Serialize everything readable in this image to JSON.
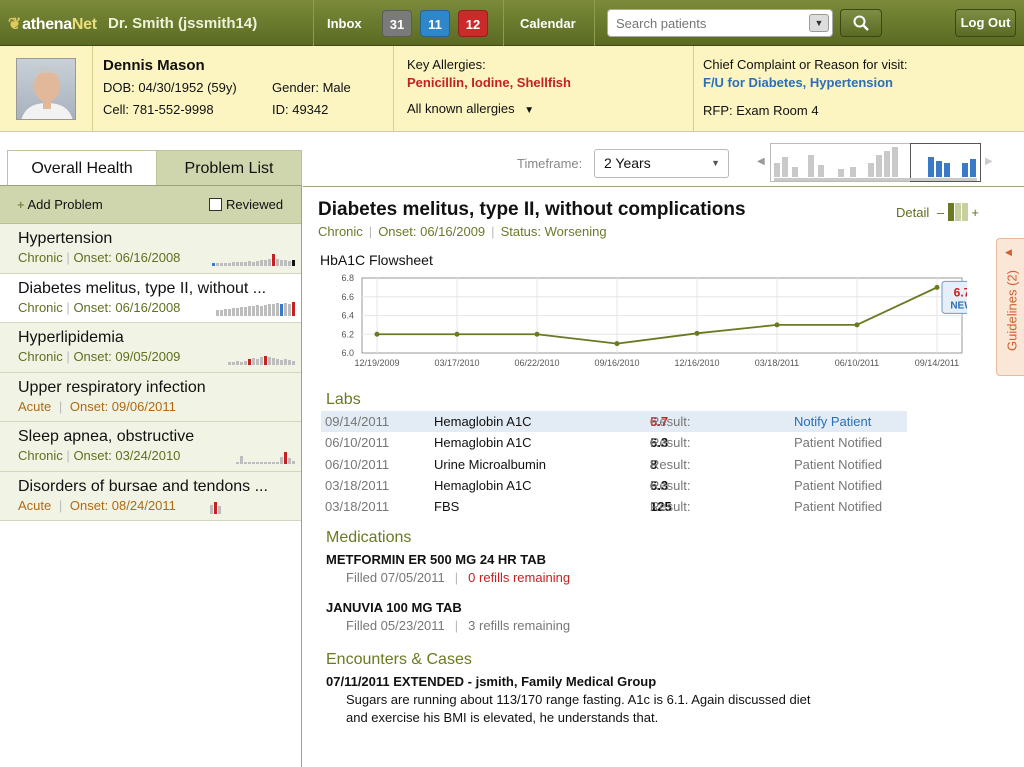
{
  "app": {
    "logo": "athena",
    "logo2": "Net",
    "doctor": "Dr. Smith (jssmith14)"
  },
  "nav": {
    "inbox": "Inbox",
    "calendar": "Calendar",
    "badges": [
      {
        "count": "31",
        "color": "#7a7a7a"
      },
      {
        "count": "11",
        "color": "#2f86c8"
      },
      {
        "count": "12",
        "color": "#c92a2a"
      }
    ],
    "search_placeholder": "Search patients",
    "logout": "Log Out"
  },
  "patient": {
    "name": "Dennis Mason",
    "dob": "DOB: 04/30/1952 (59y)",
    "gender": "Gender: Male",
    "cell": "Cell: 781-552-9998",
    "id": "ID: 49342",
    "allergies_label": "Key Allergies:",
    "allergies": "Penicillin, Iodine, Shellfish",
    "all_allergies": "All known allergies",
    "complaint_label": "Chief Complaint or Reason for visit:",
    "complaint": "F/U for Diabetes, Hypertension",
    "rfp": "RFP: Exam Room 4"
  },
  "tabs": {
    "overall": "Overall Health",
    "problems": "Problem List"
  },
  "timeframe": {
    "label": "Timeframe:",
    "value": "2 Years"
  },
  "left": {
    "add": "Add Problem",
    "reviewed": "Reviewed"
  },
  "problems": [
    {
      "title": "Hypertension",
      "status": "Chronic",
      "onset": "Onset: 06/16/2008"
    },
    {
      "title": "Diabetes melitus, type II, without ...",
      "status": "Chronic",
      "onset": "Onset: 06/16/2008"
    },
    {
      "title": "Hyperlipidemia",
      "status": "Chronic",
      "onset": "Onset: 09/05/2009"
    },
    {
      "title": "Upper respiratory infection",
      "status": "Acute",
      "onset": "Onset: 09/06/2011"
    },
    {
      "title": "Sleep apnea, obstructive",
      "status": "Chronic",
      "onset": "Onset: 03/24/2010"
    },
    {
      "title": "Disorders of bursae and tendons ...",
      "status": "Acute",
      "onset": "Onset: 08/24/2011"
    }
  ],
  "detail": {
    "title": "Diabetes melitus, type II, without complications",
    "type": "Chronic",
    "onset": "Onset: 06/16/2009",
    "status": "Status: Worsening",
    "detail_label": "Detail",
    "minus": "–",
    "plus": "+",
    "guidelines": "Guidelines (2)"
  },
  "chart_data": {
    "type": "line",
    "title": "HbA1C Flowsheet",
    "x": [
      "12/19/2009",
      "03/17/2010",
      "06/22/2010",
      "09/16/2010",
      "12/16/2010",
      "03/18/2011",
      "06/10/2011",
      "09/14/2011"
    ],
    "values": [
      6.2,
      6.2,
      6.2,
      6.1,
      6.21,
      6.3,
      6.3,
      6.7
    ],
    "ylim": [
      6.0,
      6.8
    ],
    "yticks": [
      "6.8",
      "6.6",
      "6.4",
      "6.2",
      "6.0"
    ],
    "callout_value": "6.7",
    "callout_label": "NEW"
  },
  "labs": {
    "heading": "Labs",
    "result_label": "Result:",
    "rows": [
      {
        "date": "09/14/2011",
        "test": "Hemaglobin A1C",
        "value": "6.7",
        "action": "Notify Patient"
      },
      {
        "date": "06/10/2011",
        "test": "Hemaglobin A1C",
        "value": "6.3",
        "action": "Patient Notified"
      },
      {
        "date": "06/10/2011",
        "test": "Urine Microalbumin",
        "value": "8",
        "action": "Patient Notified"
      },
      {
        "date": "03/18/2011",
        "test": "Hemaglobin A1C",
        "value": "6.3",
        "action": "Patient Notified"
      },
      {
        "date": "03/18/2011",
        "test": "FBS",
        "value": "125",
        "action": "Patient Notified"
      }
    ]
  },
  "medications": {
    "heading": "Medications",
    "items": [
      {
        "name": "METFORMIN ER 500 MG 24 HR TAB",
        "filled": "Filled 07/05/2011",
        "refills": "0 refills remaining"
      },
      {
        "name": "JANUVIA 100 MG TAB",
        "filled": "Filled 05/23/2011",
        "refills": "3 refills remaining"
      }
    ]
  },
  "encounters": {
    "heading": "Encounters & Cases",
    "title": "07/11/2011 EXTENDED - jsmith, Family Medical Group",
    "line1": "Sugars are running about 113/170 range fasting. A1c is 6.1. Again discussed diet",
    "line2": "and exercise his BMI is elevated, he understands that."
  }
}
